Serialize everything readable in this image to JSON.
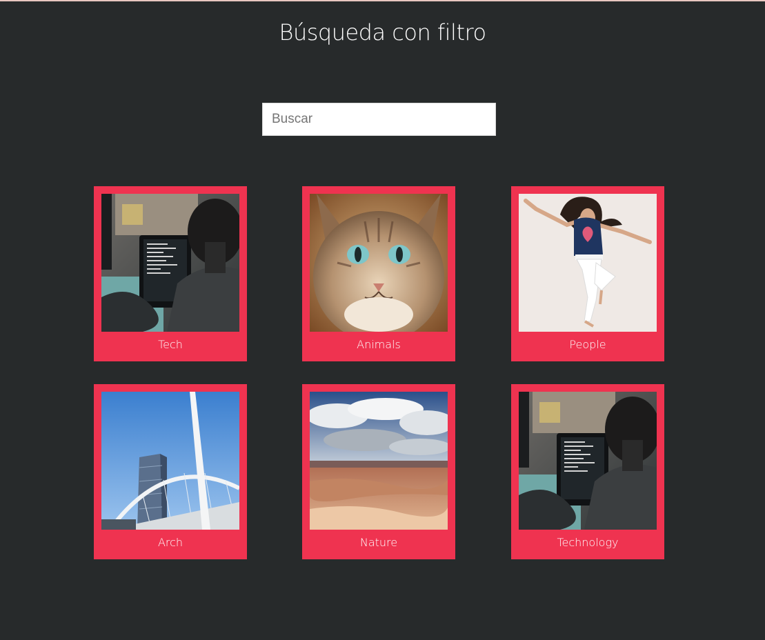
{
  "page": {
    "title": "Búsqueda con filtro"
  },
  "search": {
    "placeholder": "Buscar",
    "value": ""
  },
  "gallery": {
    "items": [
      {
        "label": "Tech",
        "image": "person-at-computer-photo"
      },
      {
        "label": "Animals",
        "image": "cat-face-photo"
      },
      {
        "label": "People",
        "image": "dancing-woman-photo"
      },
      {
        "label": "Arch",
        "image": "bridge-and-tower-photo"
      },
      {
        "label": "Nature",
        "image": "desert-clouds-photo"
      },
      {
        "label": "Technology",
        "image": "person-at-computer-photo"
      }
    ]
  },
  "colors": {
    "background": "#272a2b",
    "card": "#ef3350",
    "text": "#ffffff"
  }
}
